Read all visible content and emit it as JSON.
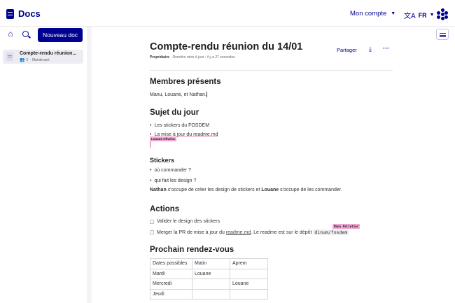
{
  "header": {
    "app_name": "Docs",
    "account_label": "Mon compte",
    "language": "FR"
  },
  "sidebar": {
    "new_doc_label": "Nouveau doc",
    "documents": [
      {
        "title": "Compte-rendu réunion...",
        "members": "2",
        "updated": "Maintenant"
      }
    ]
  },
  "document": {
    "title": "Compte-rendu réunion du 14/01",
    "meta_role": "Propriétaire",
    "meta_updated": " · Dernière mise à jour : il y a 27 secondes",
    "share_label": "Partager",
    "sections": {
      "members_heading": "Membres présents",
      "members_text": "Manu, Louane, et Nathan.",
      "subject_heading": "Sujet du jour",
      "subject_items": [
        "Les stickers du FOSDEM",
        "La mise à jour du readme.md"
      ],
      "stickers_heading": "Stickers",
      "stickers_items": [
        "où commander ?",
        "qui fait les design ?"
      ],
      "stickers_note_name1": "Nathan",
      "stickers_note_mid": " s'occupe de créer les design de stickers et ",
      "stickers_note_name2": "Louane",
      "stickers_note_end": " s'occupe de les commander.",
      "actions_heading": "Actions",
      "action_1": "Valider le design des stickers",
      "action_2_pre": "Merger la PR de mise à jour du ",
      "action_2_link": "readme.md",
      "action_2_mid": ". Le readme est sur le dépôt ",
      "action_2_code": "dinum/fosdem",
      "next_heading": "Prochain rendez-vous"
    },
    "collaborators": {
      "cursor_1": "Louane Oliveira",
      "cursor_2": "Manu Pelletier"
    },
    "table": {
      "headers": [
        "Dates possibles",
        "Matin",
        "Aprem"
      ],
      "rows": [
        [
          "Mardi",
          "Louane",
          ""
        ],
        [
          "Mercredi",
          "",
          "Louane"
        ],
        [
          "Jeudi",
          "",
          ""
        ]
      ]
    }
  }
}
